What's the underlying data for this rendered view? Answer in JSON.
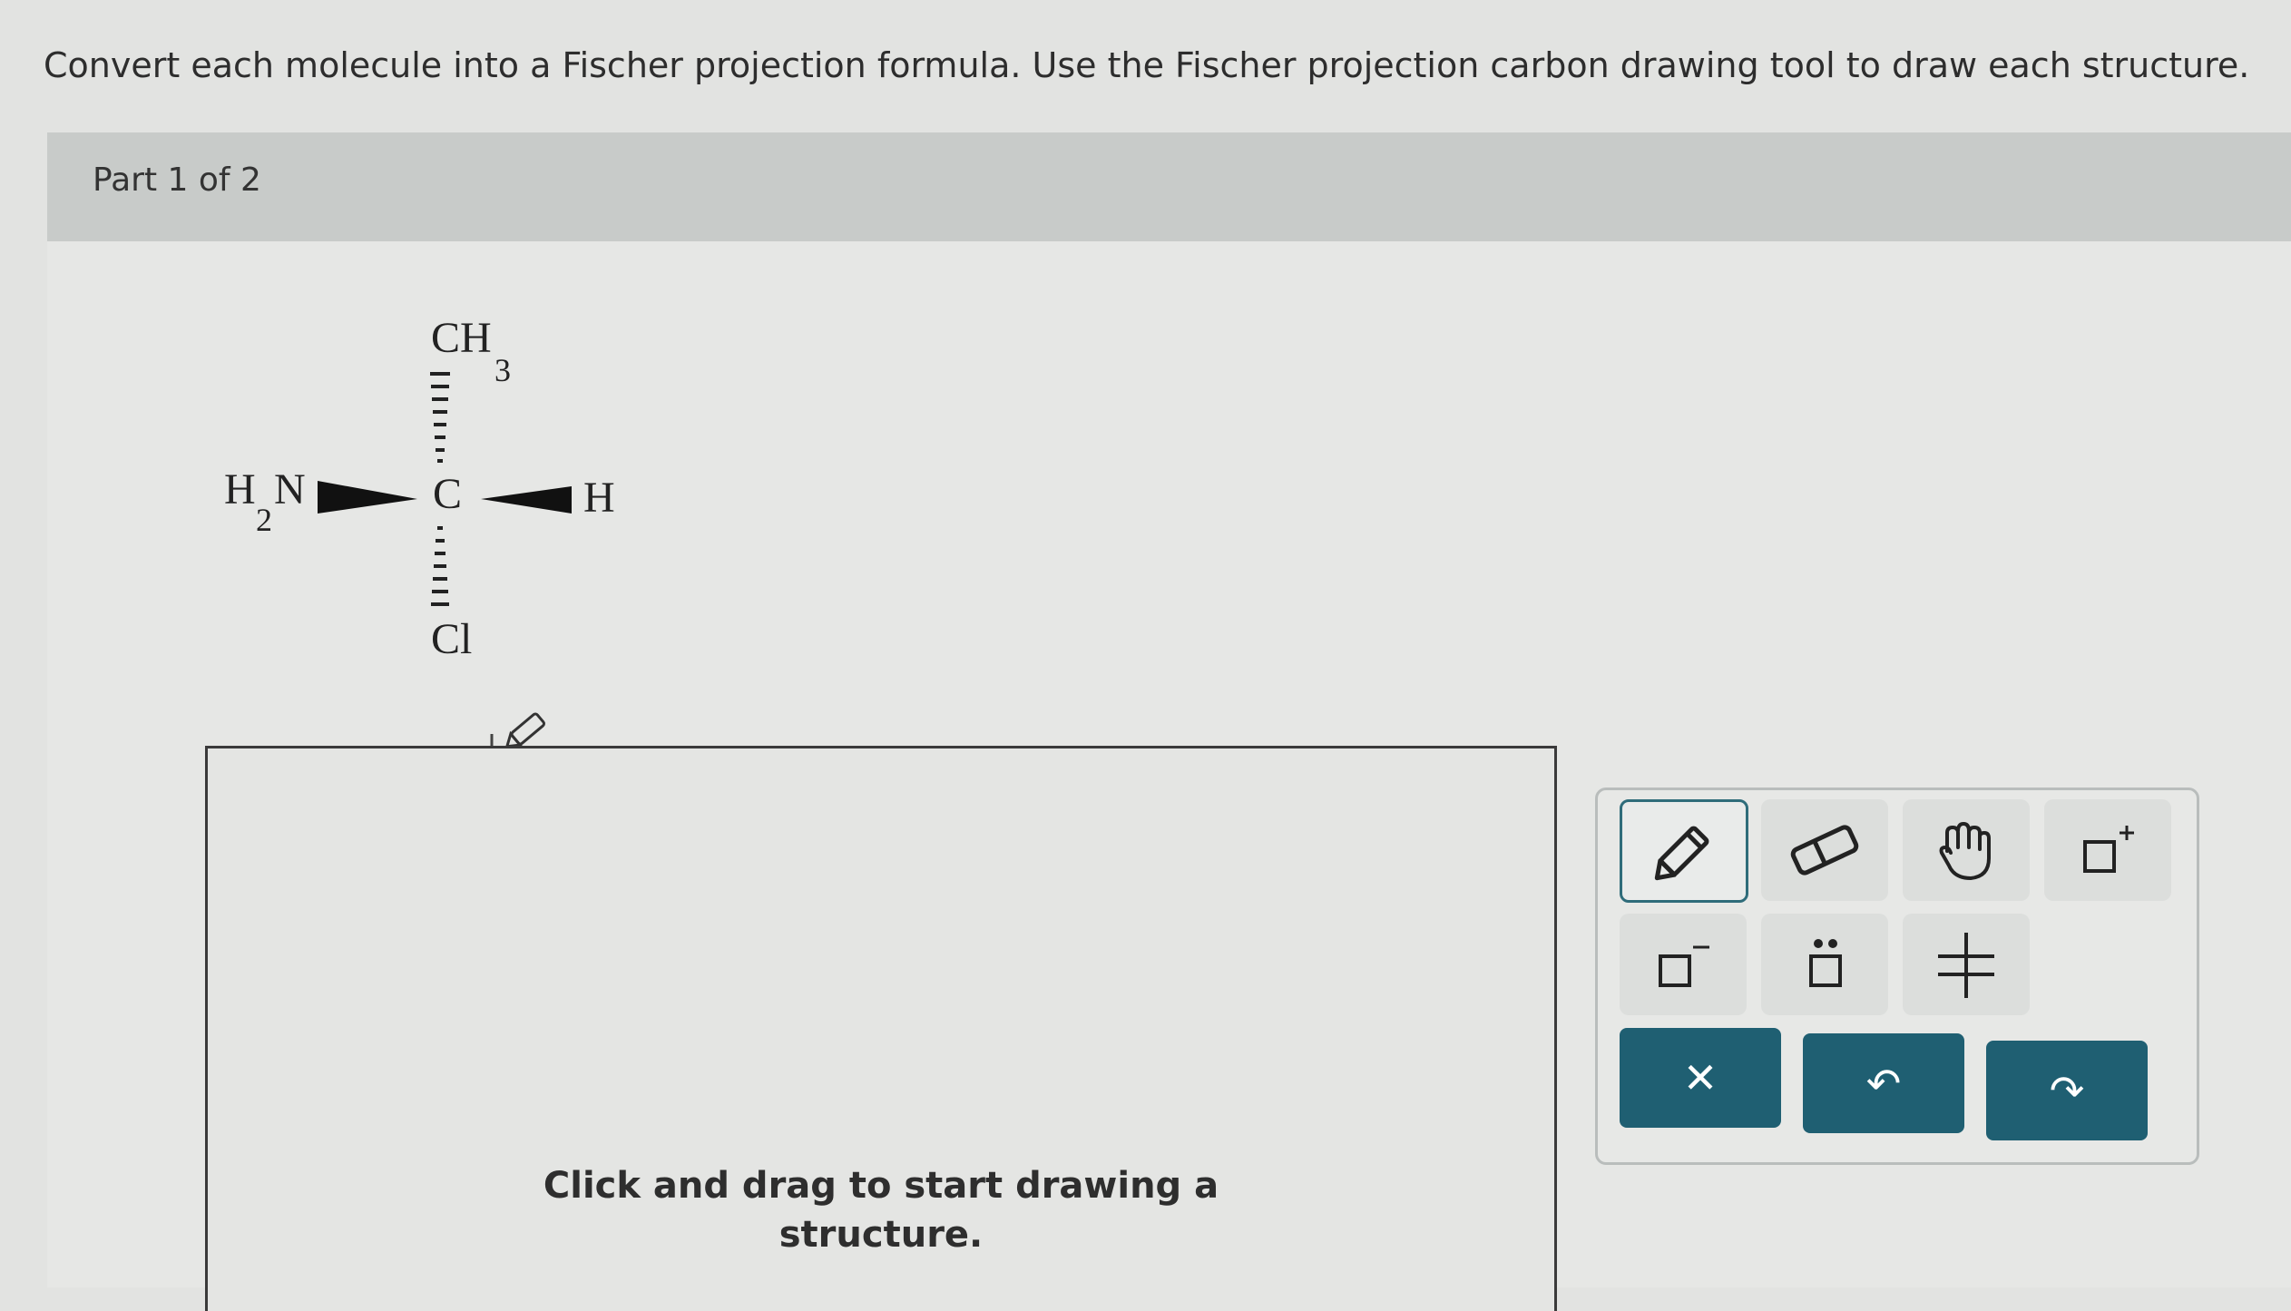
{
  "instructions": "Convert each molecule into a Fischer projection formula. Use the Fischer projection carbon drawing tool to draw each structure.",
  "part": {
    "label": "Part 1 of 2"
  },
  "molecule": {
    "top_group": "CH",
    "top_sub": "3",
    "left_group_h": "H",
    "left_sub": "2",
    "left_group_n": "N",
    "center": "C",
    "right_group": "H",
    "bottom_group": "Cl"
  },
  "canvas": {
    "hint_line1": "Click and drag to start drawing a",
    "hint_line2": "structure."
  },
  "toolbar": {
    "tools": [
      {
        "name": "pencil",
        "icon": "pencil-icon",
        "selected": true
      },
      {
        "name": "eraser",
        "icon": "eraser-icon"
      },
      {
        "name": "hand",
        "icon": "hand-icon"
      },
      {
        "name": "positive-charge",
        "icon": "positive-charge-icon"
      },
      {
        "name": "negative-charge",
        "icon": "negative-charge-icon"
      },
      {
        "name": "lone-pair",
        "icon": "lone-pair-icon"
      },
      {
        "name": "fischer-carbon",
        "icon": "fischer-carbon-icon"
      }
    ],
    "actions": [
      {
        "name": "clear",
        "icon": "close-icon",
        "glyph": "✕"
      },
      {
        "name": "undo",
        "icon": "undo-icon",
        "glyph": "↶"
      },
      {
        "name": "redo",
        "icon": "redo-icon",
        "glyph": "↷"
      }
    ],
    "accent": "#1f5f72"
  }
}
